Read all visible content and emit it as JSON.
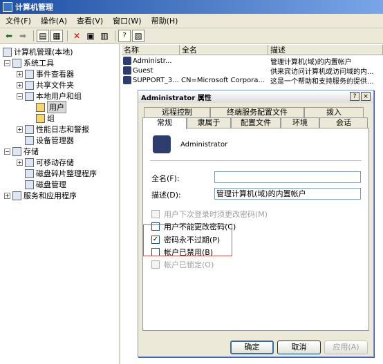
{
  "window": {
    "title": "计算机管理"
  },
  "menu": [
    "文件(F)",
    "操作(A)",
    "查看(V)",
    "窗口(W)",
    "帮助(H)"
  ],
  "tree": [
    {
      "label": "计算机管理(本地)"
    },
    {
      "label": "系统工具"
    },
    {
      "label": "事件查看器"
    },
    {
      "label": "共享文件夹"
    },
    {
      "label": "本地用户和组"
    },
    {
      "label": "用户"
    },
    {
      "label": "组"
    },
    {
      "label": "性能日志和警报"
    },
    {
      "label": "设备管理器"
    },
    {
      "label": "存储"
    },
    {
      "label": "可移动存储"
    },
    {
      "label": "磁盘碎片整理程序"
    },
    {
      "label": "磁盘管理"
    },
    {
      "label": "服务和应用程序"
    }
  ],
  "list": {
    "columns": [
      "名称",
      "全名",
      "描述"
    ],
    "rows": [
      {
        "name": "Administr...",
        "fullname": "",
        "desc": "管理计算机(域)的内置帐户"
      },
      {
        "name": "Guest",
        "fullname": "",
        "desc": "供来宾访问计算机或访问域的内..."
      },
      {
        "name": "SUPPORT_3...",
        "fullname": "CN=Microsoft Corpora...",
        "desc": "这是一个帮助和支持服务的提供..."
      }
    ]
  },
  "dialog": {
    "title": "Administrator 属性",
    "tabs_row1": [
      "远程控制",
      "终端服务配置文件",
      "拨入"
    ],
    "tabs_row2": [
      "常规",
      "隶属于",
      "配置文件",
      "环境",
      "会话"
    ],
    "username": "Administrator",
    "fullname_label": "全名(F):",
    "fullname_value": "",
    "desc_label": "描述(D):",
    "desc_value": "管理计算机(域)的内置帐户",
    "checkboxes": [
      {
        "label": "用户下次登录时须更改密码(M)"
      },
      {
        "label": "用户不能更改密码(C)"
      },
      {
        "label": "密码永不过期(P)"
      },
      {
        "label": "帐户已禁用(B)"
      },
      {
        "label": "帐户已锁定(O)"
      }
    ],
    "ok": "确定",
    "cancel": "取消",
    "apply": "应用(A)",
    "help_btn": "?",
    "close_btn": "×"
  }
}
